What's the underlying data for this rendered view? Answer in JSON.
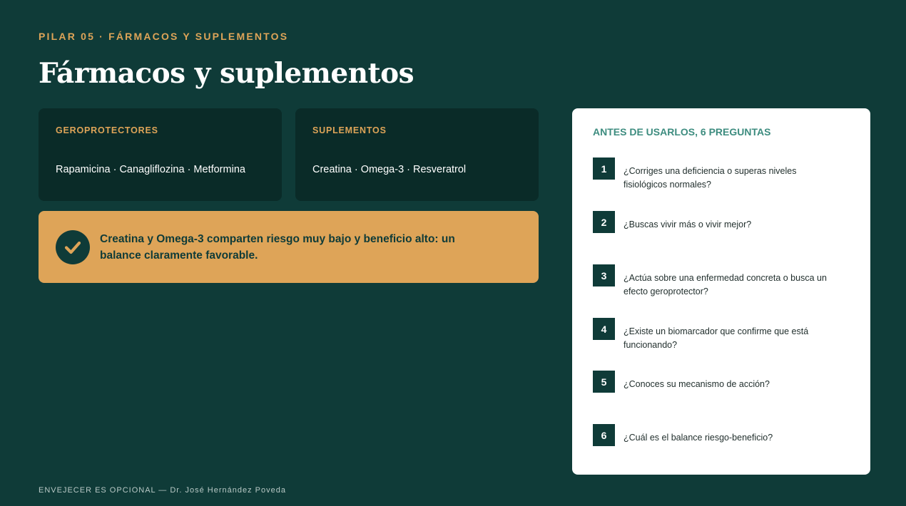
{
  "header": {
    "eyebrow": "PILAR 05 · FÁRMACOS Y SUPLEMENTOS",
    "title": "Fármacos y suplementos"
  },
  "cards": [
    {
      "label": "GEROPROTECTORES",
      "text": "Rapamicina · Canagliflozina · Metformina"
    },
    {
      "label": "SUPLEMENTOS",
      "text": "Creatina · Omega-3 · Resveratrol"
    }
  ],
  "callout": {
    "icon": "check-circle-icon",
    "text": "Creatina y Omega-3 comparten riesgo muy bajo y beneficio alto: un balance claramente favorable."
  },
  "questions_panel": {
    "title": "ANTES DE USARLOS, 6 PREGUNTAS",
    "items": [
      {
        "num": "1",
        "text": "¿Corriges una deficiencia o superas niveles fisiológicos normales?"
      },
      {
        "num": "2",
        "text": "¿Buscas vivir más o vivir mejor?"
      },
      {
        "num": "3",
        "text": "¿Actúa sobre una enfermedad concreta o busca un efecto geroprotector?"
      },
      {
        "num": "4",
        "text": "¿Existe un biomarcador que confirme que está funcionando?"
      },
      {
        "num": "5",
        "text": "¿Conoces su mecanismo de acción?"
      },
      {
        "num": "6",
        "text": "¿Cuál es el balance riesgo-beneficio?"
      }
    ]
  },
  "footer": {
    "text": "ENVEJECER ES OPCIONAL — Dr. José Hernández Poveda"
  },
  "colors": {
    "background": "#0f3b38",
    "card": "#0a2b28",
    "accent": "#dea458",
    "panel_title": "#3d8c7f"
  }
}
